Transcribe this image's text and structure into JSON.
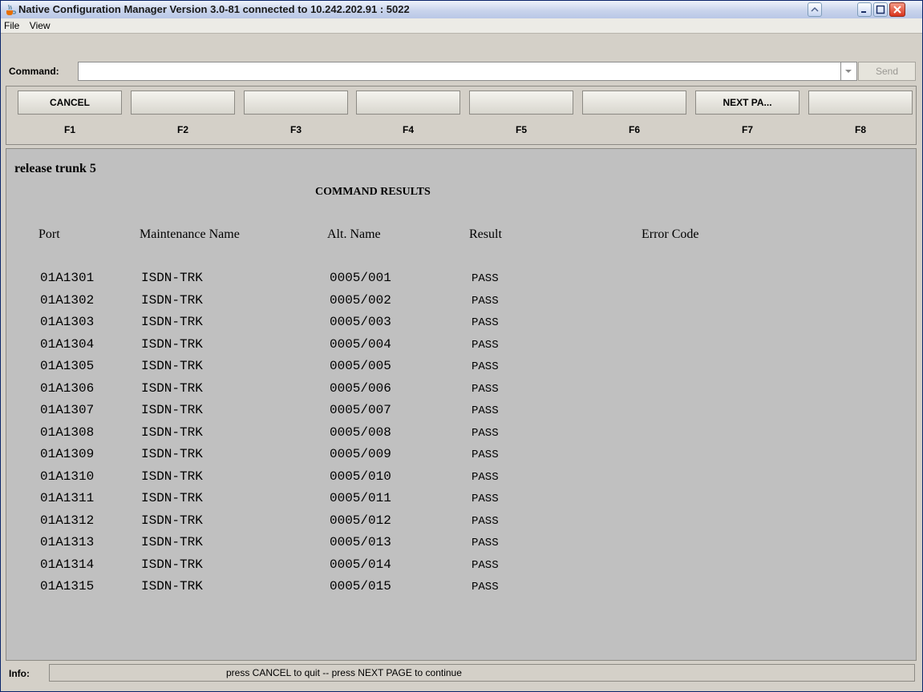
{
  "window": {
    "title": "Native Configuration Manager Version 3.0-81 connected to 10.242.202.91 : 5022"
  },
  "menu": [
    "File",
    "View"
  ],
  "command": {
    "label": "Command:",
    "value": "",
    "send_label": "Send"
  },
  "fkeys": [
    {
      "key": "F1",
      "label": "CANCEL"
    },
    {
      "key": "F2",
      "label": ""
    },
    {
      "key": "F3",
      "label": ""
    },
    {
      "key": "F4",
      "label": ""
    },
    {
      "key": "F5",
      "label": ""
    },
    {
      "key": "F6",
      "label": ""
    },
    {
      "key": "F7",
      "label": "NEXT PA..."
    },
    {
      "key": "F8",
      "label": ""
    }
  ],
  "results": {
    "command_echo": "release trunk 5",
    "title": "COMMAND RESULTS",
    "headers": [
      "Port",
      "Maintenance Name",
      "Alt. Name",
      "Result",
      "Error Code"
    ],
    "rows": [
      [
        "01A1301",
        "ISDN-TRK",
        "0005/001",
        "PASS",
        ""
      ],
      [
        "01A1302",
        "ISDN-TRK",
        "0005/002",
        "PASS",
        ""
      ],
      [
        "01A1303",
        "ISDN-TRK",
        "0005/003",
        "PASS",
        ""
      ],
      [
        "01A1304",
        "ISDN-TRK",
        "0005/004",
        "PASS",
        ""
      ],
      [
        "01A1305",
        "ISDN-TRK",
        "0005/005",
        "PASS",
        ""
      ],
      [
        "01A1306",
        "ISDN-TRK",
        "0005/006",
        "PASS",
        ""
      ],
      [
        "01A1307",
        "ISDN-TRK",
        "0005/007",
        "PASS",
        ""
      ],
      [
        "01A1308",
        "ISDN-TRK",
        "0005/008",
        "PASS",
        ""
      ],
      [
        "01A1309",
        "ISDN-TRK",
        "0005/009",
        "PASS",
        ""
      ],
      [
        "01A1310",
        "ISDN-TRK",
        "0005/010",
        "PASS",
        ""
      ],
      [
        "01A1311",
        "ISDN-TRK",
        "0005/011",
        "PASS",
        ""
      ],
      [
        "01A1312",
        "ISDN-TRK",
        "0005/012",
        "PASS",
        ""
      ],
      [
        "01A1313",
        "ISDN-TRK",
        "0005/013",
        "PASS",
        ""
      ],
      [
        "01A1314",
        "ISDN-TRK",
        "0005/014",
        "PASS",
        ""
      ],
      [
        "01A1315",
        "ISDN-TRK",
        "0005/015",
        "PASS",
        ""
      ]
    ]
  },
  "info": {
    "label": "Info:",
    "message": "press CANCEL to quit --  press NEXT PAGE to continue"
  },
  "icons": {
    "app": "java-cup-icon",
    "menu": "window-menu-icon",
    "minimize": "minimize-icon",
    "maximize": "maximize-icon",
    "close": "close-icon",
    "dropdown": "chevron-down-icon"
  },
  "colors": {
    "content_bg": "#c0c0c0",
    "window_bg": "#d4d0c8",
    "close_red": "#d9331c"
  }
}
